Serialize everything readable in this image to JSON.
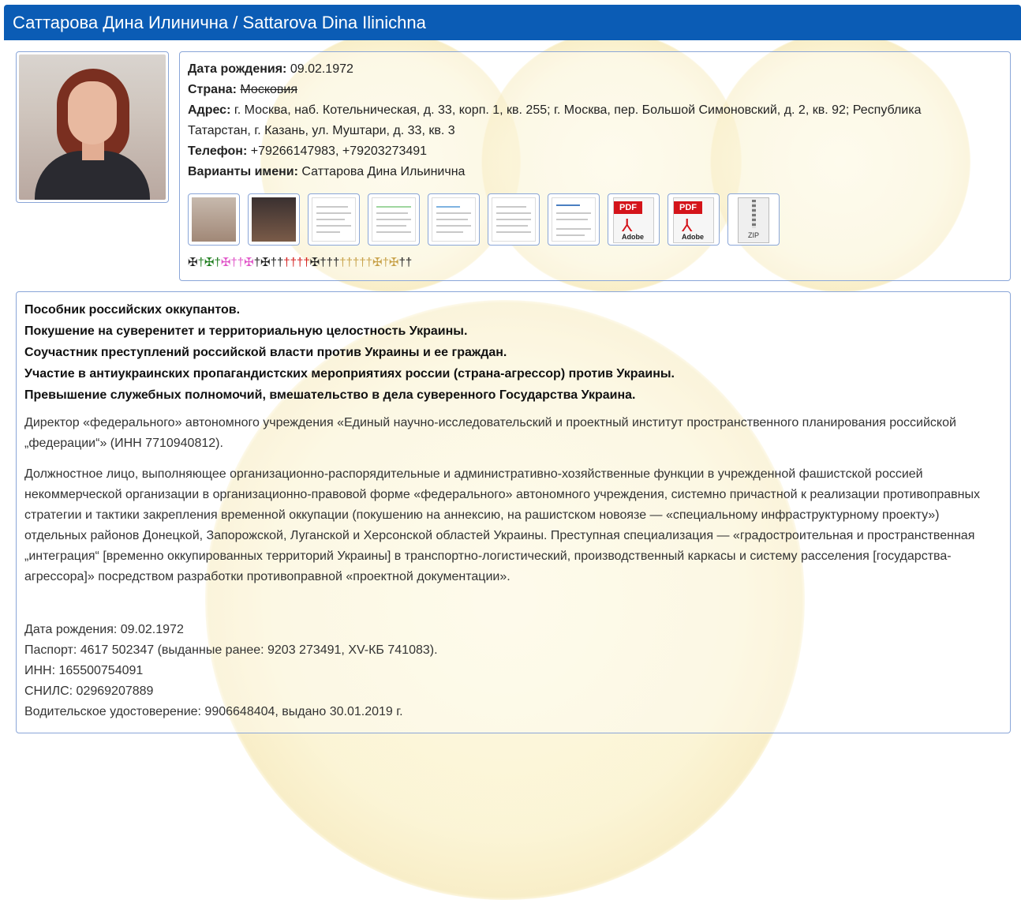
{
  "header": {
    "title": "Саттарова Дина Илинична / Sattarova Dina Ilinichna"
  },
  "info": {
    "dob_label": "Дата рождения:",
    "dob_value": " 09.02.1972",
    "country_label": "Страна:",
    "country_value": "Московия",
    "address_label": "Адрес:",
    "address_line1": " г. Москва, наб. Котельническая, д. 33, корп. 1, кв. 255; г. Москва, пер. Большой Симоновский, д. 2, кв. 92; Республика",
    "address_line2": "Татарстан, г. Казань, ул. Муштари, д. 33, кв. 3",
    "phone_label": "Телефон:",
    "phone_value": " +79266147983, +79203273491",
    "names_label": "Варианты имени:",
    "names_value": " Саттарова Дина Ильинична"
  },
  "attachments": {
    "pdf1_label": "PDF",
    "pdf1_brand": "Adobe",
    "pdf2_label": "PDF",
    "pdf2_brand": "Adobe",
    "zip_label": "ZIP"
  },
  "crosses": [
    {
      "glyph": "✠",
      "color": "#222222"
    },
    {
      "glyph": "†",
      "color": "#1e7d1e"
    },
    {
      "glyph": "✠",
      "color": "#1e7d1e"
    },
    {
      "glyph": "†",
      "color": "#1e7d1e"
    },
    {
      "glyph": "✠",
      "color": "#e055c8"
    },
    {
      "glyph": "†",
      "color": "#e055c8"
    },
    {
      "glyph": "†",
      "color": "#e055c8"
    },
    {
      "glyph": "✠",
      "color": "#e055c8"
    },
    {
      "glyph": "†",
      "color": "#222222"
    },
    {
      "glyph": "✠",
      "color": "#222222"
    },
    {
      "glyph": "†",
      "color": "#222222"
    },
    {
      "glyph": "†",
      "color": "#222222"
    },
    {
      "glyph": "†",
      "color": "#d42020"
    },
    {
      "glyph": "†",
      "color": "#d42020"
    },
    {
      "glyph": "†",
      "color": "#d42020"
    },
    {
      "glyph": "†",
      "color": "#d42020"
    },
    {
      "glyph": "✠",
      "color": "#222222"
    },
    {
      "glyph": "†",
      "color": "#222222"
    },
    {
      "glyph": "†",
      "color": "#222222"
    },
    {
      "glyph": "†",
      "color": "#222222"
    },
    {
      "glyph": "†",
      "color": "#c8a24a"
    },
    {
      "glyph": "†",
      "color": "#c8a24a"
    },
    {
      "glyph": "†",
      "color": "#c8a24a"
    },
    {
      "glyph": "†",
      "color": "#c8a24a"
    },
    {
      "glyph": "†",
      "color": "#c8a24a"
    },
    {
      "glyph": "✠",
      "color": "#c8a24a"
    },
    {
      "glyph": "†",
      "color": "#c8a24a"
    },
    {
      "glyph": "✠",
      "color": "#c8a24a"
    },
    {
      "glyph": "†",
      "color": "#222222"
    },
    {
      "glyph": "†",
      "color": "#222222"
    }
  ],
  "main": {
    "bold_1": "Пособник российских оккупантов.",
    "bold_2": "Покушение на суверенитет и территориальную целостность Украины.",
    "bold_3": "Соучастник преступлений российской власти против Украины и ее граждан.",
    "bold_4": "Участие в антиукраинских пропагандистских мероприятиях россии (страна-агрессор) против Украины.",
    "bold_5": "Превышение служебных полномочий, вмешательство в дела суверенного Государства Украина.",
    "para_1": "Директор «федерального» автономного учреждения «Единый научно-исследовательский и проектный институт пространственного планирования российской „федерации“» (ИНН 7710940812).",
    "para_2": "Должностное лицо, выполняющее организационно-распорядительные и административно-хозяйственные функции в учрежденной фашистской россией некоммерческой организации в организационно-правовой форме «федерального» автономного учреждения, системно причастной к реализации противоправных стратегии и тактики закрепления временной оккупации (покушению на аннексию, на рашистском новоязе — «специальному инфраструктурному проекту») отдельных районов Донецкой, Запорожской, Луганской и Херсонской областей Украины. Преступная специализация — «градостроительная и пространственная „интеграция“ [временно оккупированных территорий Украины] в транспортно-логистический, производственный каркасы и систему расселения [государства-агрессора]» посредством разработки противоправной «проектной документации».",
    "dob": "Дата рождения: 09.02.1972",
    "passport": "Паспорт: 4617 502347 (выданные ранее: 9203 273491, XV-КБ 741083).",
    "inn": "ИНН: 165500754091",
    "snils": "СНИЛС: 02969207889",
    "license": "Водительское удостоверение: 9906648404, выдано 30.01.2019 г."
  },
  "colors": {
    "header_bg": "#0b5cb5",
    "border": "#8aa6d8"
  }
}
